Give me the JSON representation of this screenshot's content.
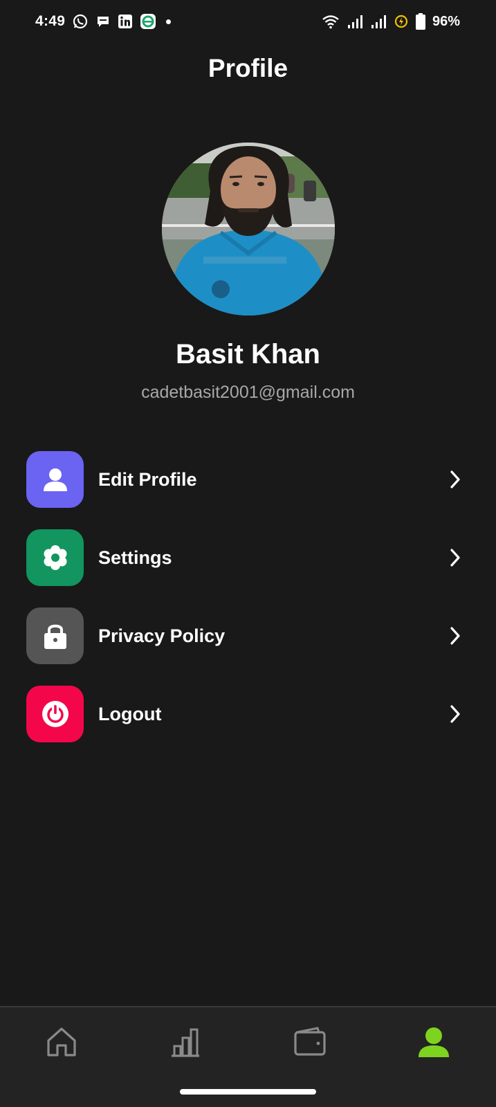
{
  "status_bar": {
    "time": "4:49",
    "battery_percent": "96%",
    "notification_icons": [
      "whatsapp-icon",
      "chat-bubble-icon",
      "linkedin-icon",
      "e-app-icon"
    ],
    "system_icons": [
      "wifi-icon",
      "signal-icon",
      "signal-icon",
      "battery-saver-icon",
      "battery-icon"
    ]
  },
  "header": {
    "title": "Profile"
  },
  "profile": {
    "name": "Basit Khan",
    "email": "cadetbasit2001@gmail.com"
  },
  "menu": {
    "items": [
      {
        "label": "Edit Profile",
        "icon": "user-icon",
        "color": "#6B63F2"
      },
      {
        "label": "Settings",
        "icon": "gear-icon",
        "color": "#12955F"
      },
      {
        "label": "Privacy Policy",
        "icon": "lock-icon",
        "color": "#555555"
      },
      {
        "label": "Logout",
        "icon": "power-icon",
        "color": "#F4074A"
      }
    ]
  },
  "bottom_nav": {
    "items": [
      {
        "icon": "home-icon",
        "active": false
      },
      {
        "icon": "bar-chart-icon",
        "active": false
      },
      {
        "icon": "wallet-icon",
        "active": false
      },
      {
        "icon": "profile-icon",
        "active": true
      }
    ],
    "active_color": "#7ED321",
    "inactive_color": "#8A8A8A"
  }
}
